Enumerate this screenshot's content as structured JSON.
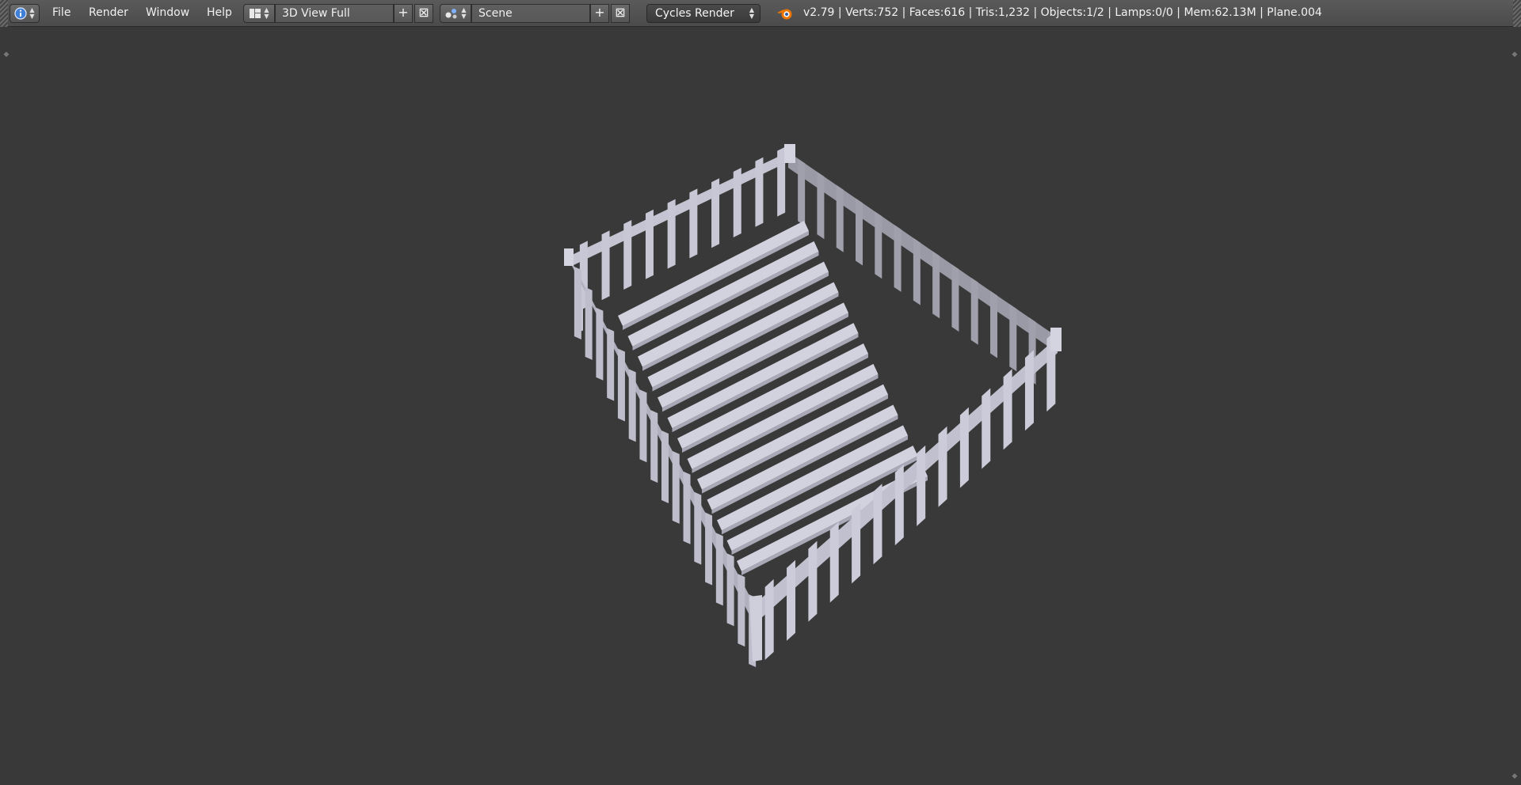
{
  "header": {
    "editor_icon": "info-icon",
    "menus": [
      "File",
      "Render",
      "Window",
      "Help"
    ],
    "layout_icon": "screen-layout-icon",
    "screen_layout": "3D View Full",
    "scene_icon": "scene-icon",
    "scene": "Scene",
    "render_engine": "Cycles Render",
    "stats": "v2.79 | Verts:752 | Faces:616 | Tris:1,232 | Objects:1/2 | Lamps:0/0 | Mem:62.13M | Plane.004"
  },
  "colors": {
    "background": "#393939",
    "header": "#4f4f4f",
    "model_light": "#c8c8d8",
    "model_dark": "#8a8a96"
  }
}
